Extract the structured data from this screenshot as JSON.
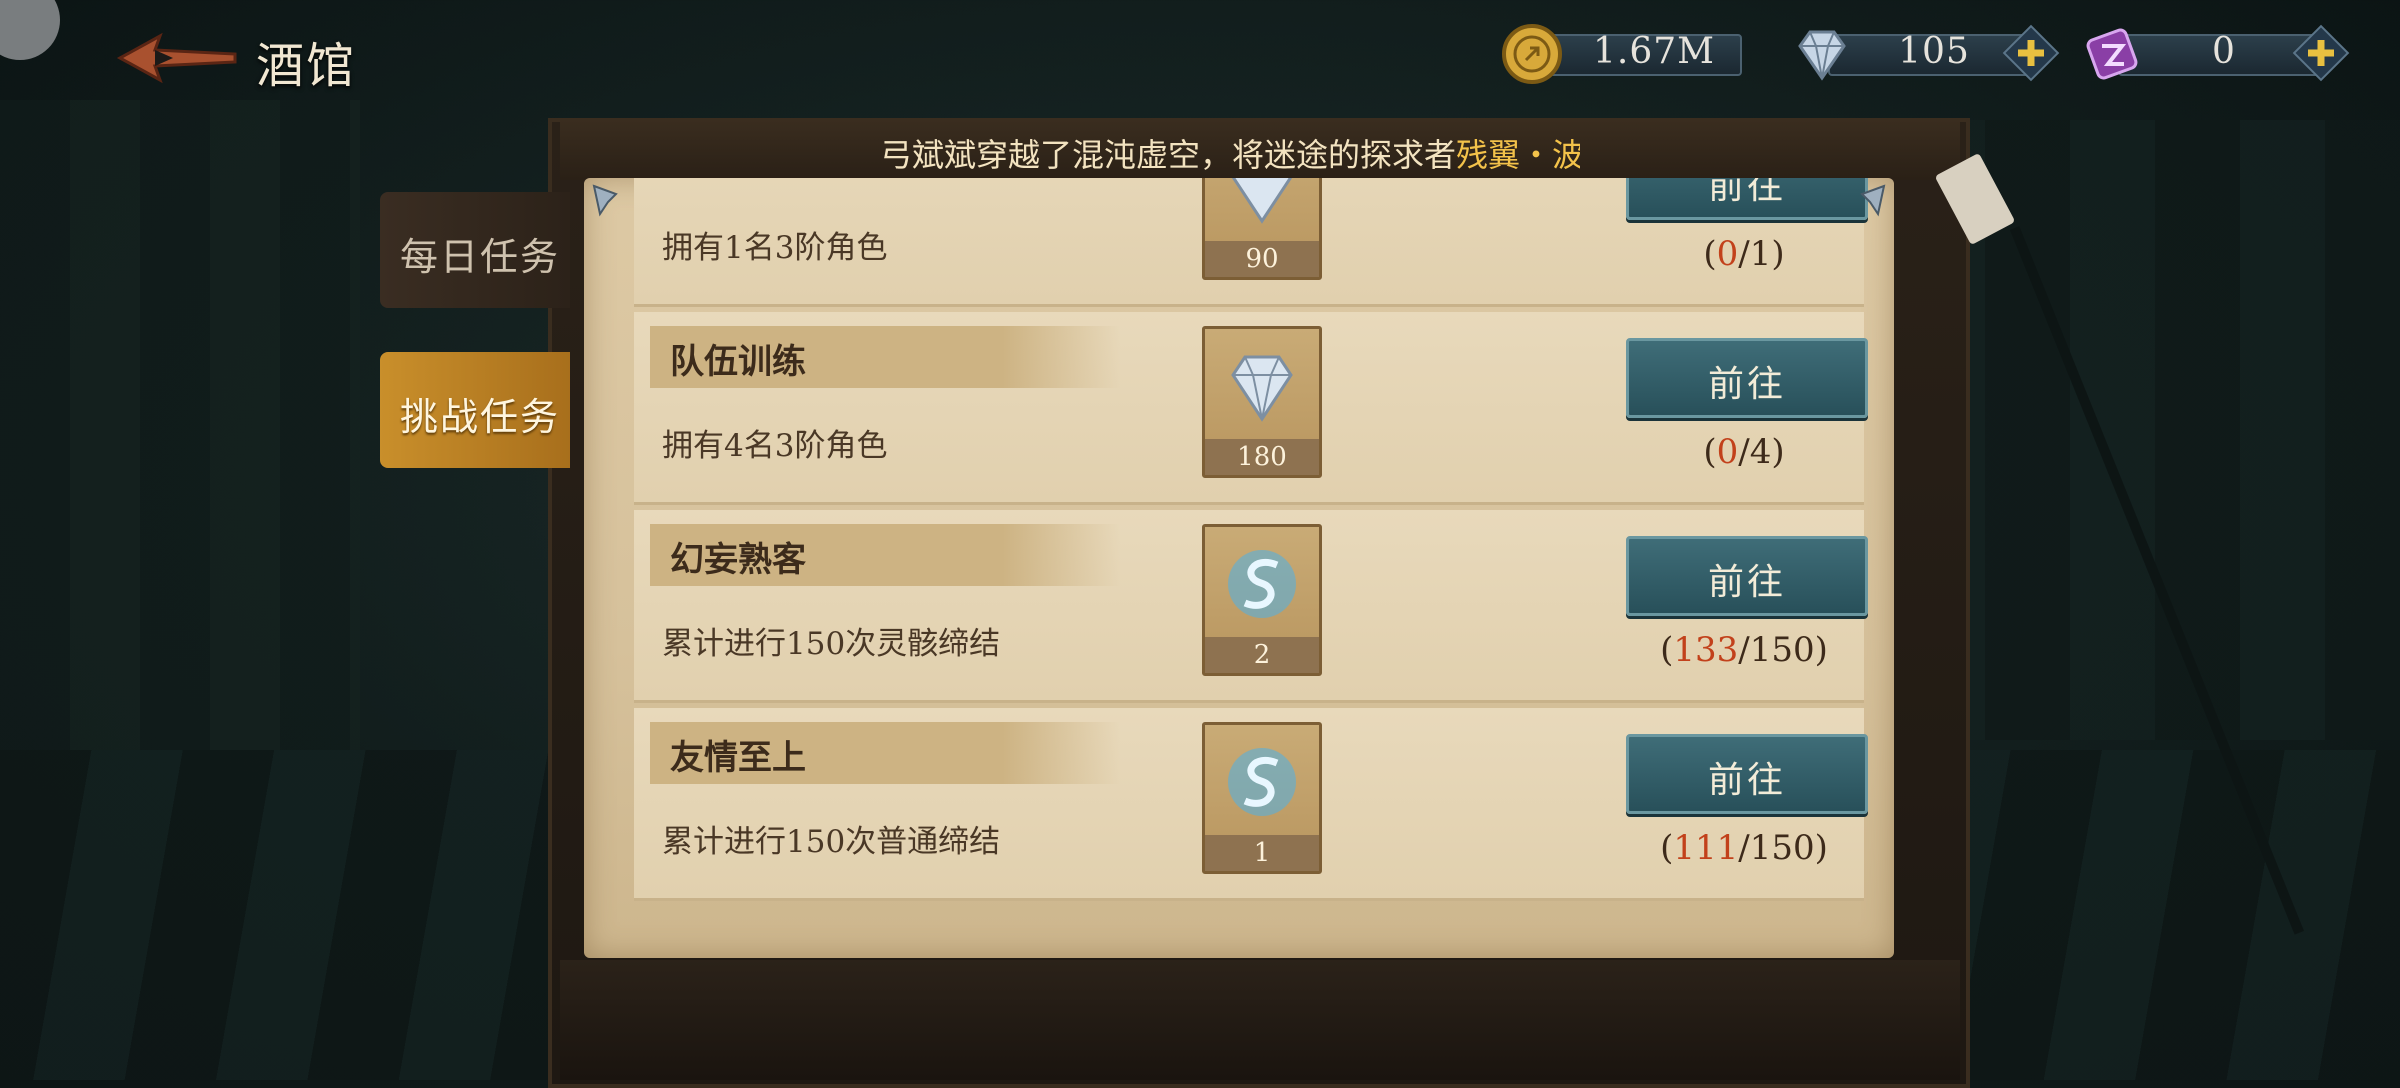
{
  "header": {
    "title": "酒馆"
  },
  "currencies": [
    {
      "id": "gold",
      "value": "1.67M",
      "has_plus": false
    },
    {
      "id": "diamond",
      "value": "105",
      "has_plus": true
    },
    {
      "id": "crystal",
      "value": "0",
      "has_plus": true
    }
  ],
  "ticker": {
    "prefix": "弓斌斌",
    "middle": "穿越了混沌虚空，将迷途的探求者",
    "highlight": "残翼・波尔"
  },
  "tabs": [
    {
      "label": "每日任务",
      "active": false
    },
    {
      "label": "挑战任务",
      "active": true
    }
  ],
  "tasks": [
    {
      "title": "",
      "desc": "拥有1名3阶角色",
      "reward_icon": "diamond-icon",
      "reward_count": "90",
      "button": "前往",
      "current": "0",
      "total": "1"
    },
    {
      "title": "队伍训练",
      "desc": "拥有4名3阶角色",
      "reward_icon": "diamond-icon",
      "reward_count": "180",
      "button": "前往",
      "current": "0",
      "total": "4"
    },
    {
      "title": "幻妄熟客",
      "desc": "累计进行150次灵骸缔结",
      "reward_icon": "spirit-orb-icon",
      "reward_count": "2",
      "button": "前往",
      "current": "133",
      "total": "150"
    },
    {
      "title": "友情至上",
      "desc": "累计进行150次普通缔结",
      "reward_icon": "spirit-orb-icon",
      "reward_count": "1",
      "button": "前往",
      "current": "111",
      "total": "150"
    }
  ],
  "colors": {
    "accent_tab": "#c98f2b",
    "button": "#3f6d78",
    "progress_current": "#c2411b",
    "parchment": "#ddc9a4"
  }
}
